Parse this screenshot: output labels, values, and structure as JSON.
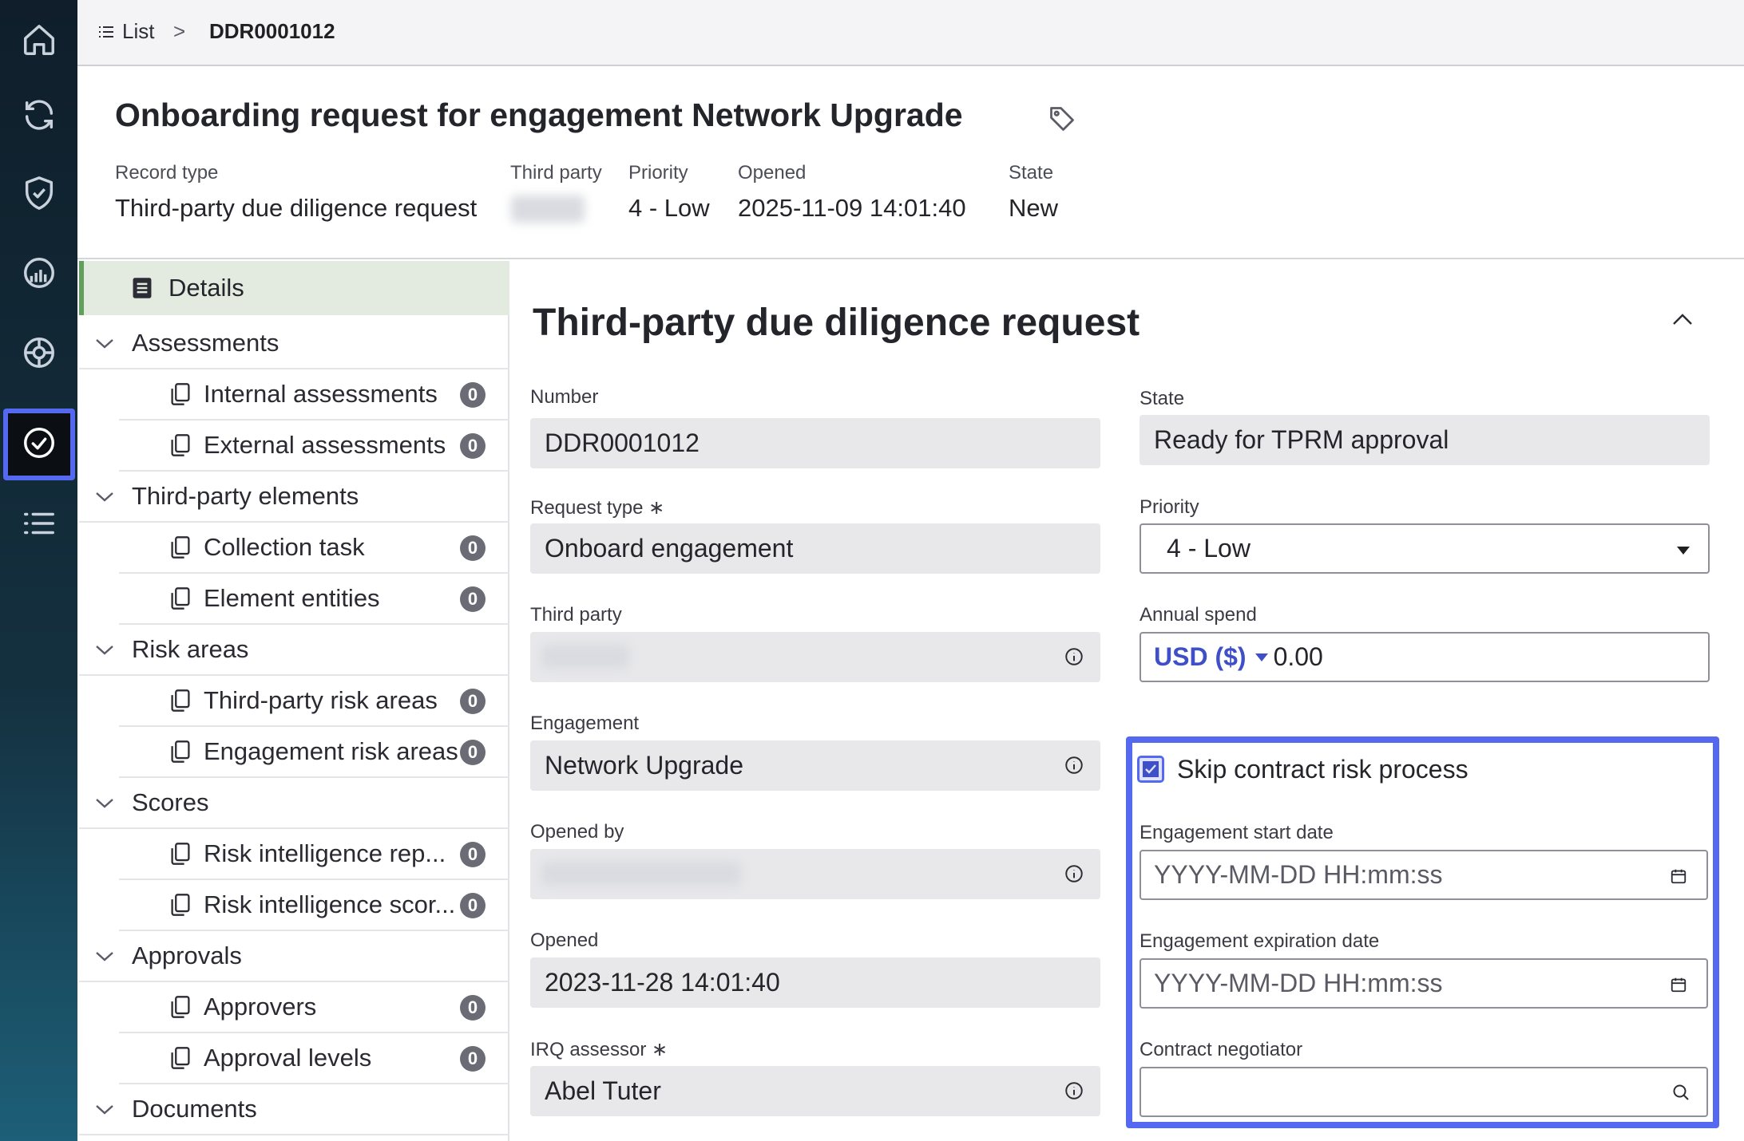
{
  "breadcrumb": {
    "list_label": "List",
    "separator": ">",
    "current": "DDR0001012"
  },
  "header": {
    "title": "Onboarding request for engagement Network Upgrade",
    "meta": {
      "record_type_label": "Record type",
      "record_type_value": "Third-party due diligence request",
      "third_party_label": "Third party",
      "priority_label": "Priority",
      "priority_value": "4 - Low",
      "opened_label": "Opened",
      "opened_value": "2025-11-09 14:01:40",
      "state_label": "State",
      "state_value": "New"
    }
  },
  "sidenav": {
    "details": "Details",
    "groups": [
      {
        "label": "Assessments",
        "items": [
          {
            "label": "Internal assessments",
            "count": "0"
          },
          {
            "label": "External assessments",
            "count": "0"
          }
        ]
      },
      {
        "label": "Third-party elements",
        "items": [
          {
            "label": "Collection task",
            "count": "0"
          },
          {
            "label": "Element entities",
            "count": "0"
          }
        ]
      },
      {
        "label": "Risk areas",
        "items": [
          {
            "label": "Third-party risk areas",
            "count": "0"
          },
          {
            "label": "Engagement risk areas",
            "count": "0"
          }
        ]
      },
      {
        "label": "Scores",
        "items": [
          {
            "label": "Risk intelligence rep...",
            "count": "0"
          },
          {
            "label": "Risk intelligence scor...",
            "count": "0"
          }
        ]
      },
      {
        "label": "Approvals",
        "items": [
          {
            "label": "Approvers",
            "count": "0"
          },
          {
            "label": "Approval levels",
            "count": "0"
          }
        ]
      },
      {
        "label": "Documents",
        "items": []
      }
    ]
  },
  "form": {
    "section_title": "Third-party due diligence request",
    "number_label": "Number",
    "number_value": "DDR0001012",
    "request_type_label": "Request type",
    "required_mark": "∗",
    "request_type_value": "Onboard engagement",
    "third_party_label": "Third party",
    "engagement_label": "Engagement",
    "engagement_value": "Network Upgrade",
    "opened_by_label": "Opened by",
    "opened_label": "Opened",
    "opened_value": "2023-11-28 14:01:40",
    "irq_assessor_label": "IRQ assessor",
    "irq_assessor_value": "Abel Tuter",
    "state_label": "State",
    "state_value": "Ready for TPRM approval",
    "priority_label": "Priority",
    "priority_value": "4 - Low",
    "annual_spend_label": "Annual spend",
    "currency": "USD ($)",
    "annual_spend_value": "0.00",
    "skip_contract_label": "Skip contract risk process",
    "skip_contract_checked": true,
    "engagement_start_label": "Engagement start date",
    "engagement_start_placeholder": "YYYY-MM-DD HH:mm:ss",
    "engagement_expiration_label": "Engagement expiration date",
    "engagement_expiration_placeholder": "YYYY-MM-DD HH:mm:ss",
    "contract_negotiator_label": "Contract negotiator"
  },
  "colors": {
    "accent": "#5468f0",
    "active_nav": "#5fa15a",
    "rail": "#14303f"
  }
}
